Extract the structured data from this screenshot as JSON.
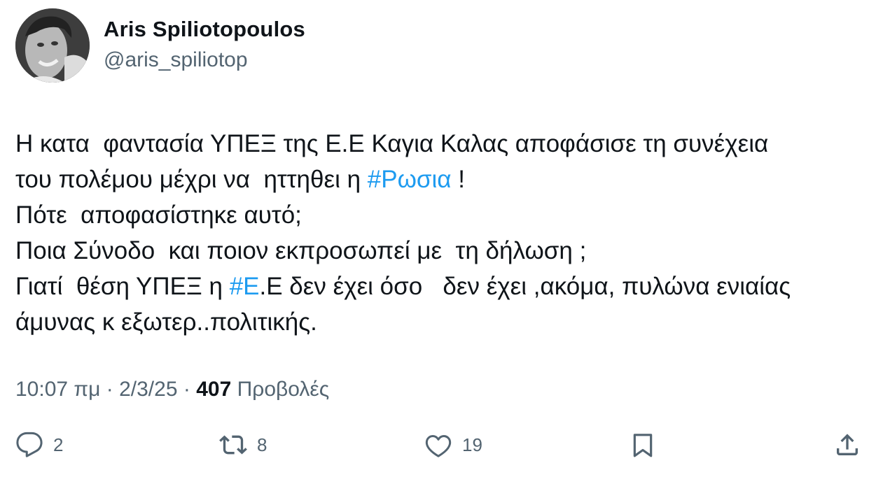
{
  "author": {
    "display_name": "Aris Spiliotopoulos",
    "handle": "@aris_spiliotop"
  },
  "tweet": {
    "lines": [
      [
        {
          "text": "Η κατα  φαντασία ΥΠΕΞ της Ε.Ε Καγια Καλας αποφάσισε τη συνέχεια",
          "hashtag": false
        }
      ],
      [
        {
          "text": "του πολέμου μέχρι να  ηττηθει η ",
          "hashtag": false
        },
        {
          "text": "#Ρωσια",
          "hashtag": true
        },
        {
          "text": " !",
          "hashtag": false
        }
      ],
      [
        {
          "text": "Πότε  αποφασίστηκε αυτό;",
          "hashtag": false
        }
      ],
      [
        {
          "text": "Ποια Σύνοδο  και ποιον εκπροσωπεί με  τη δήλωση ;",
          "hashtag": false
        }
      ],
      [
        {
          "text": "Γιατί  θέση ΥΠΕΞ η ",
          "hashtag": false
        },
        {
          "text": "#Ε",
          "hashtag": true
        },
        {
          "text": ".Ε δεν έχει όσο   δεν έχει ,ακόμα, πυλώνα ενιαίας",
          "hashtag": false
        }
      ],
      [
        {
          "text": "άμυνας κ εξωτερ..πολιτικής.",
          "hashtag": false
        }
      ]
    ]
  },
  "meta": {
    "time": "10:07 πμ",
    "separator": "·",
    "date": "2/3/25",
    "views_count": "407",
    "views_label": "Προβολές"
  },
  "actions": {
    "reply_count": "2",
    "retweet_count": "8",
    "like_count": "19",
    "icons": [
      "reply-icon",
      "retweet-icon",
      "like-icon",
      "bookmark-icon",
      "share-icon"
    ]
  },
  "colors": {
    "text": "#0f1419",
    "secondary": "#536471",
    "hashtag": "#1d9bf0",
    "background": "#ffffff"
  }
}
